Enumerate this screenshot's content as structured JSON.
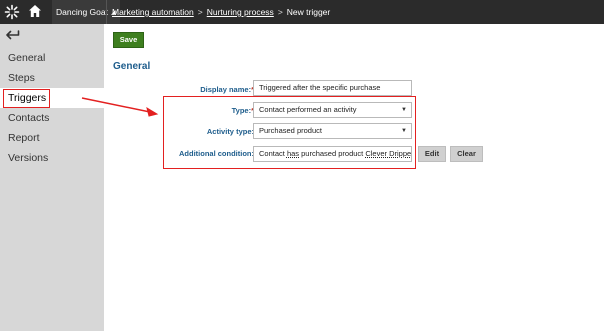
{
  "topbar": {
    "logo_icon": "kentico-logo-icon",
    "home_icon": "home-icon",
    "site_name": "Dancing Goat",
    "breadcrumb": {
      "item1": "Marketing automation",
      "item2": "Nurturing process",
      "current": "New trigger",
      "separator": ">"
    }
  },
  "sidebar": {
    "back_icon": "back-arrow-icon",
    "items": [
      {
        "label": "General"
      },
      {
        "label": "Steps"
      },
      {
        "label": "Triggers"
      },
      {
        "label": "Contacts"
      },
      {
        "label": "Report"
      },
      {
        "label": "Versions"
      }
    ],
    "active_index": 2
  },
  "form": {
    "save_label": "Save",
    "section_title": "General",
    "display_name_label": "Display name:",
    "display_name_value": "Triggered after the specific purchase",
    "type_label": "Type:",
    "type_value": "Contact performed an activity",
    "activity_type_label": "Activity type:",
    "activity_type_value": "Purchased product",
    "additional_condition_label": "Additional condition:",
    "additional_condition_prefix": "Contact ",
    "additional_condition_word1": "has",
    "additional_condition_middle": " purchased product ",
    "additional_condition_word2": "Clever Dripper",
    "edit_label": "Edit",
    "clear_label": "Clear",
    "required_mark": "*"
  },
  "annotations": {
    "highlight_color": "#e32020"
  }
}
